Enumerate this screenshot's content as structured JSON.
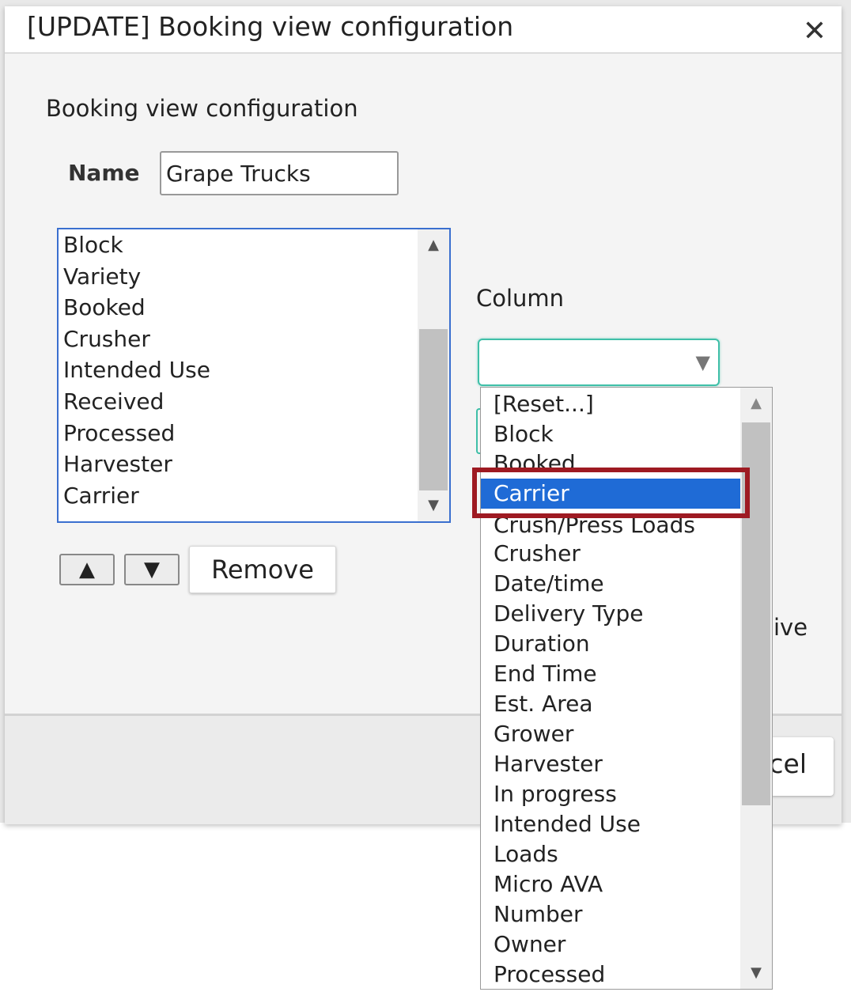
{
  "dialog": {
    "title": "[UPDATE] Booking view configuration",
    "close_symbol": "✕",
    "section_title": "Booking view configuration"
  },
  "name_field": {
    "label": "Name",
    "value": "Grape Trucks"
  },
  "selected_columns": {
    "items": [
      "Block",
      "Variety",
      "Booked",
      "Crusher",
      "Intended Use",
      "Received",
      "Processed",
      "Harvester",
      "Carrier"
    ],
    "scroll_up_symbol": "▲",
    "scroll_down_symbol": "▼"
  },
  "buttons": {
    "move_up_symbol": "▲",
    "move_down_symbol": "▼",
    "remove_label": "Remove",
    "cancel_label_visible": "cel"
  },
  "column_select": {
    "label": "Column",
    "value": "",
    "caret_symbol": "▼"
  },
  "partial_text": "ive",
  "dropdown": {
    "options": [
      "[Reset...]",
      "Block",
      "Booked",
      "Carrier",
      "Crush/Press Loads",
      "Crusher",
      "Date/time",
      "Delivery Type",
      "Duration",
      "End Time",
      "Est. Area",
      "Grower",
      "Harvester",
      "In progress",
      "Intended Use",
      "Loads",
      "Micro AVA",
      "Number",
      "Owner",
      "Processed"
    ],
    "highlighted": "Carrier",
    "scroll_up_symbol": "▲",
    "scroll_down_symbol": "▼"
  },
  "colors": {
    "selection": "#1f6bd6",
    "highlight_border": "#9e1a22",
    "focus_border": "#3fbfa8",
    "list_border": "#3a6fcf"
  }
}
